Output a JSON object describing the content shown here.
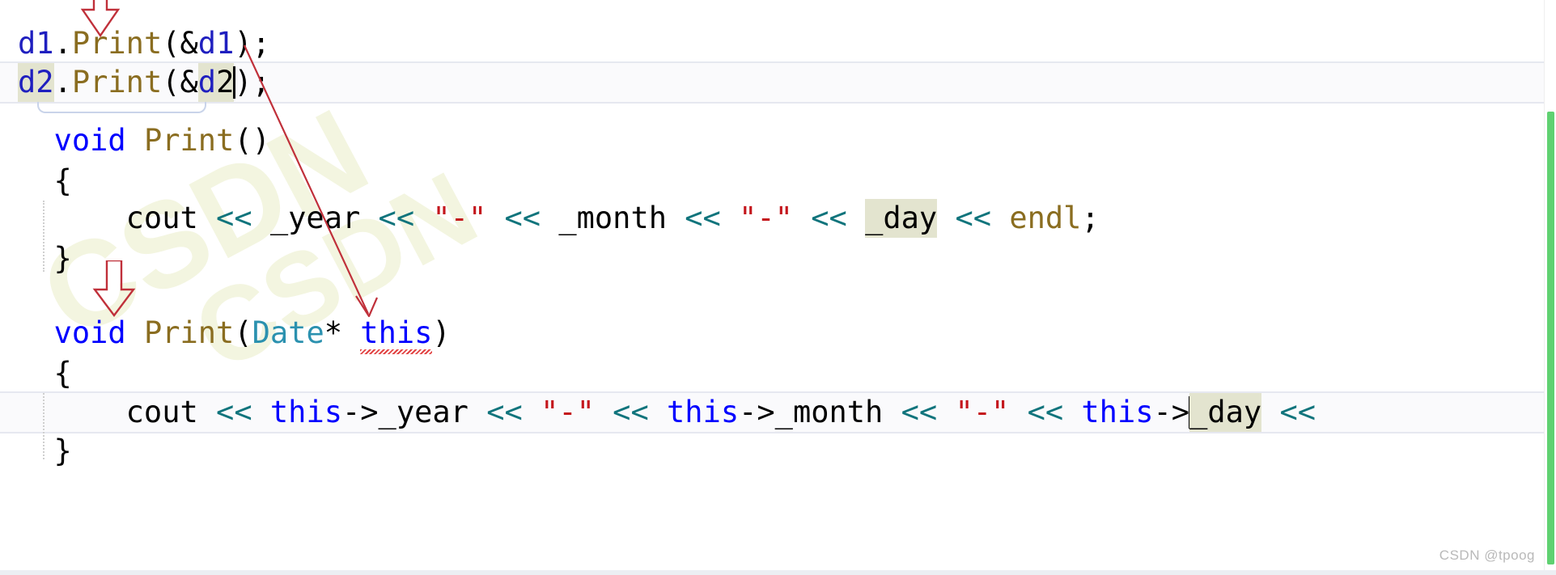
{
  "editor": {
    "language": "cpp",
    "background_color": "#ffffff",
    "font_size_px": 37
  },
  "colors": {
    "keyword": "#0000ff",
    "function": "#8a6d20",
    "type": "#2b91af",
    "operator": "#10747c",
    "string": "#c4161c",
    "identifier": "#1f1fbf",
    "plain_text": "#000000",
    "reference_highlight_bg": "#e3e4cf",
    "current_line_bg": "#fafafc",
    "current_line_border": "#e6e8f0",
    "annotation_red": "#c0303a",
    "squiggle_red": "#e03a3a",
    "scroll_marker_green": "#5fd171",
    "region_box_border": "#c9d4ea"
  },
  "code": {
    "lines": [
      {
        "id": "line-call-d1",
        "tokens": [
          {
            "text": "d1",
            "cls": "ident"
          },
          {
            "text": ".",
            "cls": "plain"
          },
          {
            "text": "Print",
            "cls": "fn"
          },
          {
            "text": "(&",
            "cls": "plain"
          },
          {
            "text": "d1",
            "cls": "ident"
          },
          {
            "text": ");",
            "cls": "plain"
          }
        ],
        "plain": "d1.Print(&d1);"
      },
      {
        "id": "line-call-d2",
        "tokens": [
          {
            "text": "d2",
            "cls": "ident ref-hl"
          },
          {
            "text": ".",
            "cls": "plain"
          },
          {
            "text": "Print",
            "cls": "fn"
          },
          {
            "text": "(&",
            "cls": "plain"
          },
          {
            "text": "d",
            "cls": "ident ref-hl"
          },
          {
            "text": "2",
            "cls": "plain ref-hl"
          },
          {
            "text": "\u0000CARET",
            "cls": "caret"
          },
          {
            "text": ");",
            "cls": "plain"
          }
        ],
        "plain": "d2.Print(&d2);"
      },
      {
        "id": "line-print-noargs-sig",
        "tokens": [
          {
            "text": "  ",
            "cls": "plain"
          },
          {
            "text": "void",
            "cls": "kw"
          },
          {
            "text": " ",
            "cls": "plain"
          },
          {
            "text": "Print",
            "cls": "fn"
          },
          {
            "text": "()",
            "cls": "plain"
          }
        ],
        "plain": "  void Print()"
      },
      {
        "id": "line-open-brace-1",
        "tokens": [
          {
            "text": "  {",
            "cls": "plain"
          }
        ],
        "plain": "  {"
      },
      {
        "id": "line-cout-members",
        "tokens": [
          {
            "text": "      ",
            "cls": "plain"
          },
          {
            "text": "cout",
            "cls": "plain"
          },
          {
            "text": " ",
            "cls": "plain"
          },
          {
            "text": "<<",
            "cls": "op"
          },
          {
            "text": " _year ",
            "cls": "plain"
          },
          {
            "text": "<<",
            "cls": "op"
          },
          {
            "text": " ",
            "cls": "plain"
          },
          {
            "text": "\"-\"",
            "cls": "str"
          },
          {
            "text": " ",
            "cls": "plain"
          },
          {
            "text": "<<",
            "cls": "op"
          },
          {
            "text": " _month ",
            "cls": "plain"
          },
          {
            "text": "<<",
            "cls": "op"
          },
          {
            "text": " ",
            "cls": "plain"
          },
          {
            "text": "\"-\"",
            "cls": "str"
          },
          {
            "text": " ",
            "cls": "plain"
          },
          {
            "text": "<<",
            "cls": "op"
          },
          {
            "text": " ",
            "cls": "plain"
          },
          {
            "text": "_day",
            "cls": "plain ref-hl"
          },
          {
            "text": " ",
            "cls": "plain"
          },
          {
            "text": "<<",
            "cls": "op"
          },
          {
            "text": " ",
            "cls": "plain"
          },
          {
            "text": "endl",
            "cls": "fn"
          },
          {
            "text": ";",
            "cls": "plain"
          }
        ],
        "plain": "      cout << _year << \"-\" << _month << \"-\" << _day << endl;"
      },
      {
        "id": "line-close-brace-1",
        "tokens": [
          {
            "text": "  }",
            "cls": "plain"
          }
        ],
        "plain": "  }"
      },
      {
        "id": "line-blank",
        "tokens": [
          {
            "text": " ",
            "cls": "plain"
          }
        ],
        "plain": ""
      },
      {
        "id": "line-print-this-sig",
        "tokens": [
          {
            "text": "  ",
            "cls": "plain"
          },
          {
            "text": "void",
            "cls": "kw"
          },
          {
            "text": " ",
            "cls": "plain"
          },
          {
            "text": "Print",
            "cls": "fn"
          },
          {
            "text": "(",
            "cls": "plain"
          },
          {
            "text": "Date",
            "cls": "type"
          },
          {
            "text": "* ",
            "cls": "plain"
          },
          {
            "text": "this",
            "cls": "kw squiggle"
          },
          {
            "text": ")",
            "cls": "plain"
          }
        ],
        "plain": "  void Print(Date* this)"
      },
      {
        "id": "line-open-brace-2",
        "tokens": [
          {
            "text": "  {",
            "cls": "plain"
          }
        ],
        "plain": "  {"
      },
      {
        "id": "line-cout-this-members",
        "tokens": [
          {
            "text": "      ",
            "cls": "plain"
          },
          {
            "text": "cout",
            "cls": "plain"
          },
          {
            "text": " ",
            "cls": "plain"
          },
          {
            "text": "<<",
            "cls": "op"
          },
          {
            "text": " ",
            "cls": "plain"
          },
          {
            "text": "this",
            "cls": "kw"
          },
          {
            "text": "->_year ",
            "cls": "plain"
          },
          {
            "text": "<<",
            "cls": "op"
          },
          {
            "text": " ",
            "cls": "plain"
          },
          {
            "text": "\"-\"",
            "cls": "str"
          },
          {
            "text": " ",
            "cls": "plain"
          },
          {
            "text": "<<",
            "cls": "op"
          },
          {
            "text": " ",
            "cls": "plain"
          },
          {
            "text": "this",
            "cls": "kw"
          },
          {
            "text": "->_month ",
            "cls": "plain"
          },
          {
            "text": "<<",
            "cls": "op"
          },
          {
            "text": " ",
            "cls": "plain"
          },
          {
            "text": "\"-\"",
            "cls": "str"
          },
          {
            "text": " ",
            "cls": "plain"
          },
          {
            "text": "<<",
            "cls": "op"
          },
          {
            "text": " ",
            "cls": "plain"
          },
          {
            "text": "this",
            "cls": "kw"
          },
          {
            "text": "->",
            "cls": "plain"
          },
          {
            "text": "\u0000CARET",
            "cls": "caret"
          },
          {
            "text": "_day",
            "cls": "plain ref-hl"
          },
          {
            "text": " ",
            "cls": "plain"
          },
          {
            "text": "<<",
            "cls": "op"
          }
        ],
        "plain": "      cout << this->_year << \"-\" << this->_month << \"-\" << this->_day <<"
      },
      {
        "id": "line-close-brace-2",
        "tokens": [
          {
            "text": "  }",
            "cls": "plain"
          }
        ],
        "plain": "  }"
      }
    ]
  },
  "annotations": {
    "arrows": [
      {
        "id": "arrow-to-print-call",
        "label": "down-arrow-top"
      },
      {
        "id": "arrow-to-print-this",
        "label": "down-arrow-mid"
      }
    ],
    "pointer_line": {
      "id": "line-d2-to-this-param",
      "label": "diagonal-pointer-line"
    }
  },
  "watermark": {
    "text": "CSDN @tpoog",
    "background_text": "CSDN"
  },
  "scrollbar": {
    "marker_color": "#5fd171",
    "marker_label": "modified-region-marker"
  }
}
